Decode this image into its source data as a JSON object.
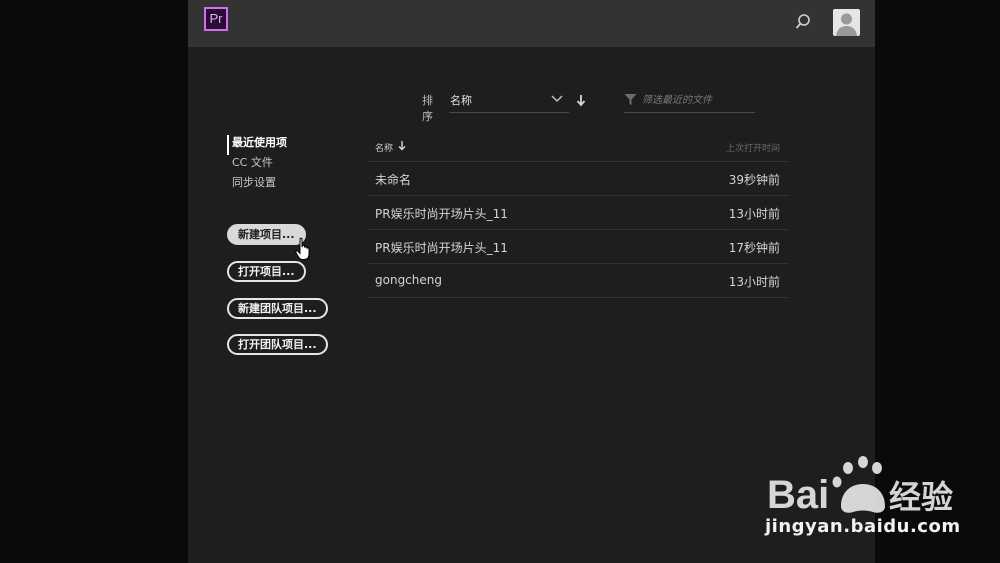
{
  "app": {
    "logo_text": "Pr"
  },
  "sort": {
    "label": "排序",
    "value": "名称"
  },
  "filter": {
    "placeholder": "筛选最近的文件"
  },
  "nav": {
    "items": [
      {
        "label": "最近使用项"
      },
      {
        "label": "CC 文件"
      },
      {
        "label": "同步设置"
      }
    ]
  },
  "buttons": {
    "new_project": "新建项目...",
    "open_project": "打开项目...",
    "new_team_project": "新建团队项目...",
    "open_team_project": "打开团队项目..."
  },
  "table": {
    "col_name": "名称",
    "col_time": "上次打开时间",
    "rows": [
      {
        "name": "未命名",
        "time": "39秒钟前"
      },
      {
        "name": "PR娱乐时尚开场片头_11",
        "time": "13小时前"
      },
      {
        "name": "PR娱乐时尚开场片头_11",
        "time": "17秒钟前"
      },
      {
        "name": "gongcheng",
        "time": "13小时前"
      }
    ]
  },
  "watermark": {
    "text": "jingyan.baidu.com",
    "brand": "Bai du 经验"
  },
  "colors": {
    "accent": "#d86cf0",
    "panel": "#1e1e1e",
    "topbar": "#333333"
  },
  "icons": [
    "premiere-logo-icon",
    "search-icon",
    "avatar-icon",
    "chevron-down-icon",
    "sort-direction-icon",
    "filter-icon",
    "hand-cursor-icon"
  ]
}
